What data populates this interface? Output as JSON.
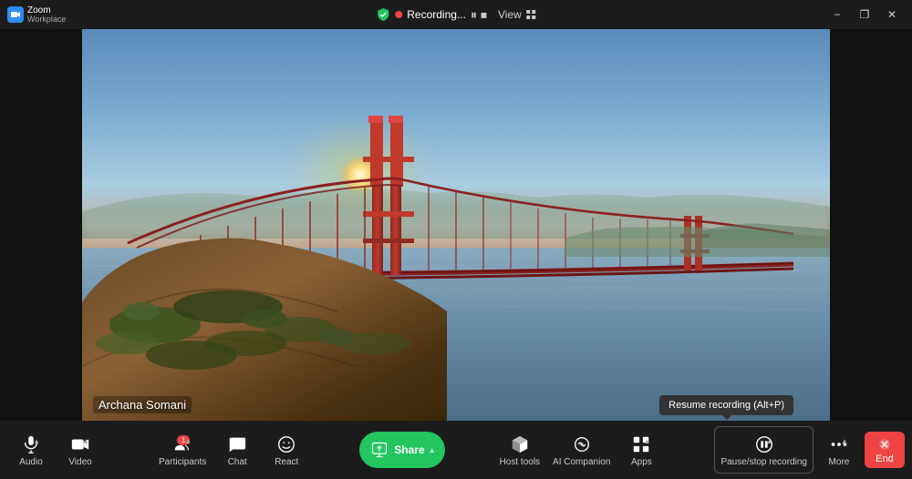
{
  "app": {
    "name": "Zoom",
    "subtitle": "Workplace"
  },
  "titlebar": {
    "recording_label": "Recording...",
    "view_label": "View",
    "minimize_label": "−",
    "restore_label": "❐",
    "close_label": "✕"
  },
  "video": {
    "participant_name": "Archana Somani"
  },
  "toolbar": {
    "audio_label": "Audio",
    "video_label": "Video",
    "participants_label": "Participants",
    "participants_count": "1",
    "chat_label": "Chat",
    "react_label": "React",
    "share_label": "Share",
    "host_tools_label": "Host tools",
    "ai_companion_label": "AI Companion",
    "apps_label": "Apps",
    "pause_stop_label": "Pause/stop recording",
    "more_label": "More",
    "end_label": "End"
  },
  "tooltip": {
    "text": "Resume recording (Alt+P)"
  }
}
